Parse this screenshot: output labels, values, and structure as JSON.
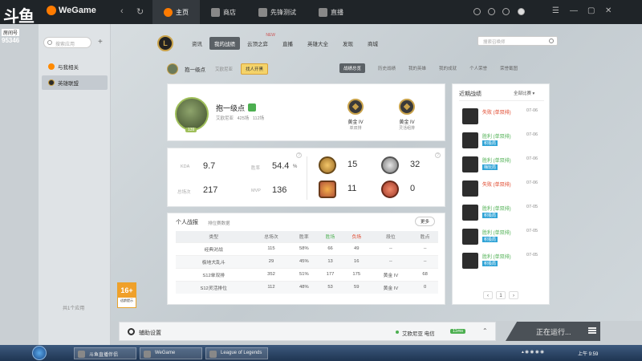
{
  "brand": {
    "logo_text": "斗鱼",
    "sub": "房间号",
    "room": "95346"
  },
  "app": {
    "name": "WeGame"
  },
  "topnav": {
    "tabs": [
      "主页",
      "商店",
      "先锋测试",
      "直播"
    ]
  },
  "sidebar": {
    "search_placeholder": "搜索应用",
    "items": [
      "与我相关",
      "英雄联盟"
    ],
    "footer": "共1个应用"
  },
  "age_rating": {
    "number": "16+",
    "text": "适龄提示"
  },
  "lolnav": {
    "items": [
      "资讯",
      "我的战绩",
      "云顶之弈",
      "直播",
      "英雄大全",
      "发现",
      "商城"
    ],
    "new_tag": "NEW",
    "search_placeholder": "搜索召唤师"
  },
  "subbar": {
    "name": "抱一级点",
    "region": "艾欧尼亚",
    "pill": "找人开黑",
    "tabs": [
      "战绩总览",
      "历史战绩",
      "我的英雄",
      "我的成就",
      "个人荣誉",
      "荣誉截图"
    ]
  },
  "profile": {
    "name": "抱一级点",
    "region": "艾欧尼亚",
    "games_label": "425场",
    "ranked_label": "112场",
    "level": "139",
    "ranks": [
      {
        "tier": "黄金 IV",
        "queue": "单双排"
      },
      {
        "tier": "黄金 IV",
        "queue": "灵活组排"
      }
    ]
  },
  "stats": {
    "kda_label": "KDA",
    "kda": "9.7",
    "winrate_label": "胜率",
    "winrate": "54.4",
    "winrate_unit": "%",
    "total_label": "总场次",
    "total": "217",
    "mvp_label": "MVP",
    "mvp": "136",
    "medals": [
      "15",
      "32",
      "11",
      "0"
    ]
  },
  "records": {
    "title": "个人战报",
    "subtitle": "排位赛数据",
    "more": "更多"
  },
  "recent": {
    "title": "近期战绩",
    "filter": "全部比赛",
    "matches": [
      {
        "result": "失败 (单双排)",
        "date": "07-06",
        "tag": ""
      },
      {
        "result": "胜利 (单双排)",
        "date": "07-06",
        "tag": "积极局"
      },
      {
        "result": "胜利 (单双排)",
        "date": "07-06",
        "tag": "嗨玩局"
      },
      {
        "result": "失败 (单双排)",
        "date": "07-06",
        "tag": ""
      },
      {
        "result": "胜利 (单双排)",
        "date": "07-05",
        "tag": "积极局"
      },
      {
        "result": "胜利 (单双排)",
        "date": "07-05",
        "tag": "积极局"
      },
      {
        "result": "胜利 (单双排)",
        "date": "07-05",
        "tag": "积极局"
      }
    ],
    "page": "1"
  },
  "assist": {
    "label": "辅助设置",
    "news": "艾欧尼亚 电信",
    "time": "11ms"
  },
  "running": {
    "label": "正在运行..."
  },
  "taskbar": {
    "tasks": [
      "斗鱼直播伴侣",
      "WeGame",
      "League of Legends"
    ],
    "clock": "上午 9:59"
  },
  "chart_data": {
    "type": "table",
    "title": "个人战报",
    "columns": [
      "类型",
      "总场次",
      "胜率",
      "胜场",
      "负场",
      "段位",
      "胜点"
    ],
    "rows": [
      [
        "经典对战",
        "115",
        "58%",
        "66",
        "49",
        "--",
        "--"
      ],
      [
        "极地大乱斗",
        "29",
        "45%",
        "13",
        "16",
        "--",
        "--"
      ],
      [
        "S12单双排",
        "352",
        "51%",
        "177",
        "175",
        "黄金 IV",
        "68"
      ],
      [
        "S12灵活排位",
        "112",
        "48%",
        "53",
        "59",
        "黄金 IV",
        "0"
      ]
    ]
  }
}
